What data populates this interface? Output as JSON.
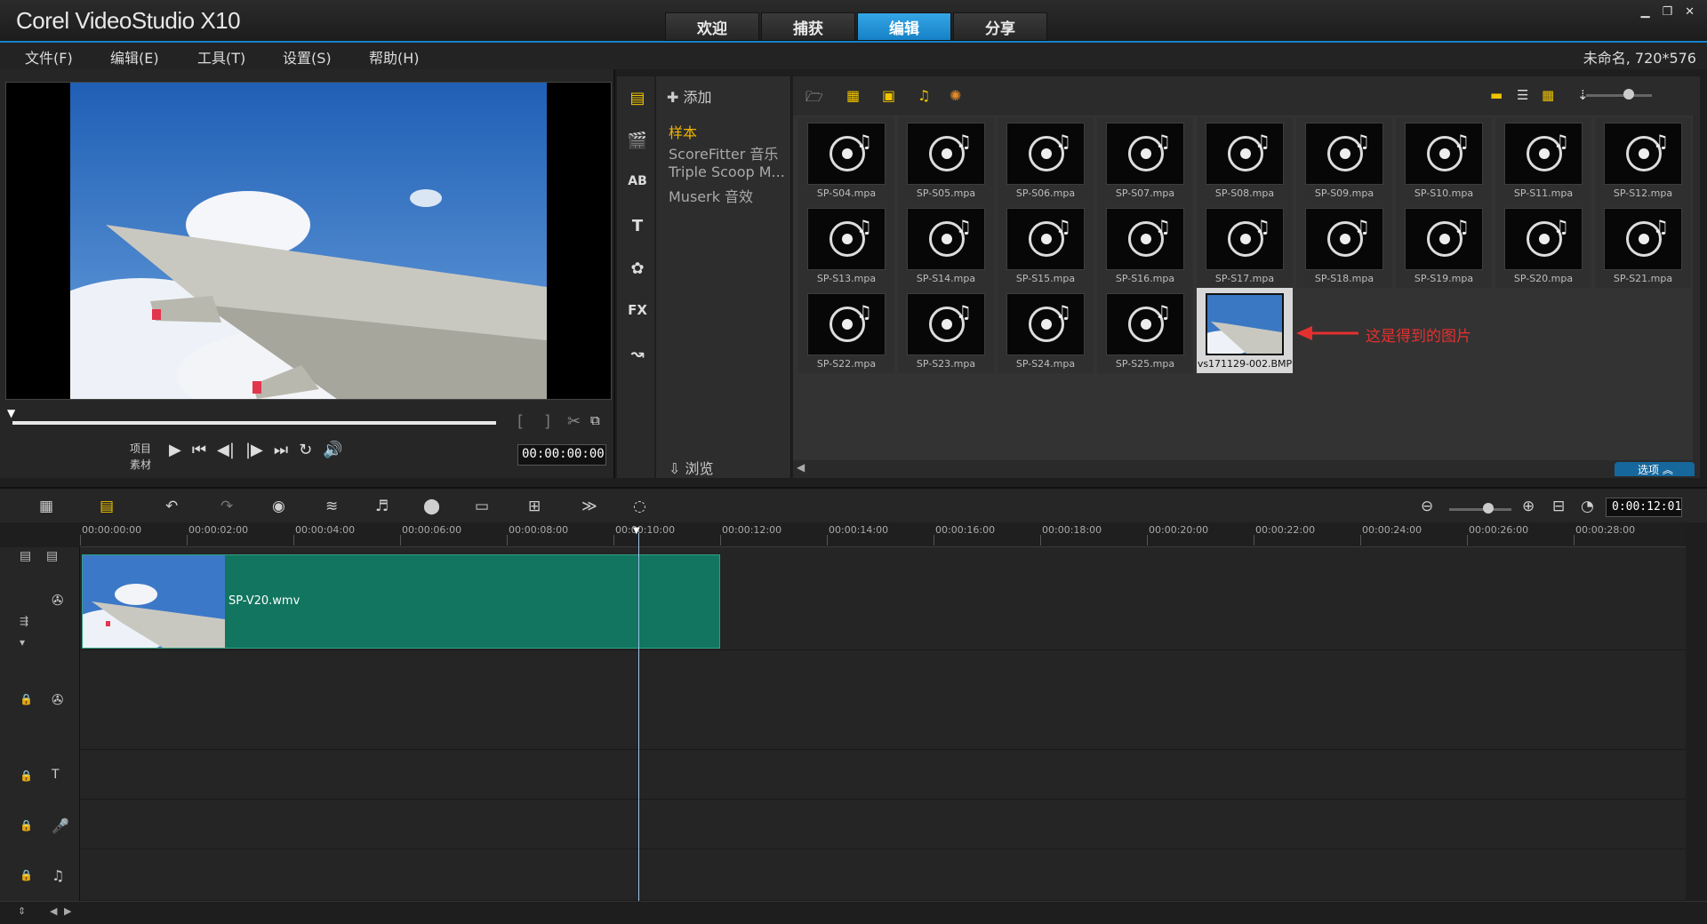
{
  "app": {
    "title": "Corel VideoStudio X10",
    "tabs": [
      {
        "label": "欢迎",
        "active": false
      },
      {
        "label": "捕获",
        "active": false
      },
      {
        "label": "编辑",
        "active": true
      },
      {
        "label": "分享",
        "active": false
      }
    ],
    "accent_color": "#1683c8"
  },
  "menu": {
    "items": [
      "文件(F)",
      "编辑(E)",
      "工具(T)",
      "设置(S)",
      "帮助(H)"
    ],
    "project_info": "未命名, 720*576"
  },
  "preview": {
    "mode_project": "项目",
    "mode_clip": "素材",
    "timecode": "00:00:00:00"
  },
  "library": {
    "add_label": "添加",
    "folders": [
      {
        "label": "样本",
        "active": true
      },
      {
        "label": "ScoreFitter 音乐",
        "active": false
      },
      {
        "label": "Triple Scoop M...",
        "active": false
      },
      {
        "label": "Muserk 音效",
        "active": false
      }
    ],
    "browse_label": "浏览",
    "options_label": "选项",
    "sidebar_icons": [
      "media-icon",
      "instant-project-icon",
      "transition-icon",
      "title-icon",
      "graphic-icon",
      "filter-icon",
      "path-icon"
    ],
    "items": [
      {
        "label": "SP-S04.mpa",
        "kind": "audio"
      },
      {
        "label": "SP-S05.mpa",
        "kind": "audio"
      },
      {
        "label": "SP-S06.mpa",
        "kind": "audio"
      },
      {
        "label": "SP-S07.mpa",
        "kind": "audio"
      },
      {
        "label": "SP-S08.mpa",
        "kind": "audio"
      },
      {
        "label": "SP-S09.mpa",
        "kind": "audio"
      },
      {
        "label": "SP-S10.mpa",
        "kind": "audio"
      },
      {
        "label": "SP-S11.mpa",
        "kind": "audio"
      },
      {
        "label": "SP-S12.mpa",
        "kind": "audio"
      },
      {
        "label": "SP-S13.mpa",
        "kind": "audio"
      },
      {
        "label": "SP-S14.mpa",
        "kind": "audio"
      },
      {
        "label": "SP-S15.mpa",
        "kind": "audio"
      },
      {
        "label": "SP-S16.mpa",
        "kind": "audio"
      },
      {
        "label": "SP-S17.mpa",
        "kind": "audio"
      },
      {
        "label": "SP-S18.mpa",
        "kind": "audio"
      },
      {
        "label": "SP-S19.mpa",
        "kind": "audio"
      },
      {
        "label": "SP-S20.mpa",
        "kind": "audio"
      },
      {
        "label": "SP-S21.mpa",
        "kind": "audio"
      },
      {
        "label": "SP-S22.mpa",
        "kind": "audio"
      },
      {
        "label": "SP-S23.mpa",
        "kind": "audio"
      },
      {
        "label": "SP-S24.mpa",
        "kind": "audio"
      },
      {
        "label": "SP-S25.mpa",
        "kind": "audio"
      },
      {
        "label": "vs171129-002.BMP",
        "kind": "image",
        "selected": true
      }
    ],
    "annotation": "这是得到的图片",
    "annotation_color": "#e53030"
  },
  "timeline": {
    "timecode": "0:00:12:01",
    "ruler": [
      "00:00:00:00",
      "00:00:02:00",
      "00:00:04:00",
      "00:00:06:00",
      "00:00:08:00",
      "00:00:10:00",
      "00:00:12:00",
      "00:00:14:00",
      "00:00:16:00",
      "00:00:18:00",
      "00:00:20:00",
      "00:00:22:00",
      "00:00:24:00",
      "00:00:26:00",
      "00:00:28:00"
    ],
    "clip_name": "SP-V20.wmv",
    "clip_color": "#127560"
  }
}
